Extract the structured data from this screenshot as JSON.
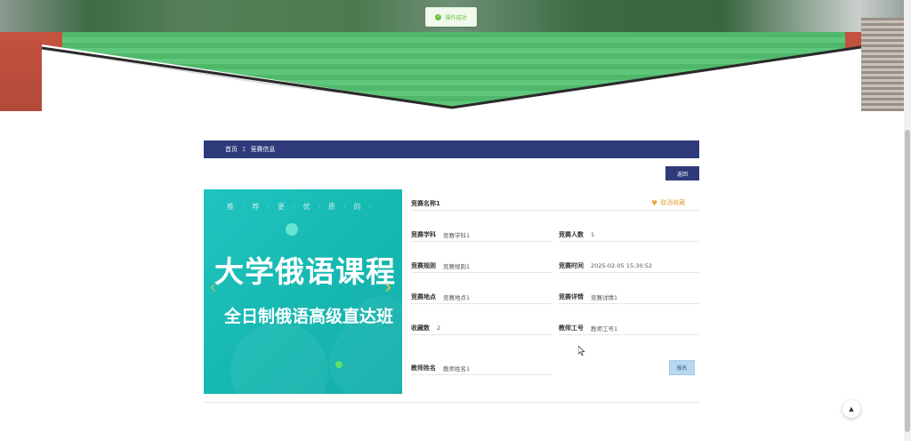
{
  "toast": {
    "text": "操作成功",
    "icon": "check-circle-icon",
    "color": "#67c23a"
  },
  "breadcrumb": {
    "home": "首页",
    "separator": "Ξ",
    "current": "竞赛信息"
  },
  "back_button": "返回",
  "carousel": {
    "top_text": "推·荐·更·优·质·的·",
    "title": "大学俄语课程",
    "subtitle": "全日制俄语高级直达班",
    "prev_icon": "chevron-left-icon",
    "next_icon": "chevron-right-icon"
  },
  "detail": {
    "title": "竞赛名称1",
    "favorite": {
      "label": "取消收藏",
      "icon": "heart-icon"
    },
    "fields": {
      "subject": {
        "label": "竞赛学科",
        "value": "竞赛学科1"
      },
      "count": {
        "label": "竞赛人数",
        "value": "1"
      },
      "rules": {
        "label": "竞赛规则",
        "value": "竞赛规则1"
      },
      "time": {
        "label": "竞赛时间",
        "value": "2025-02-05 15:30:52"
      },
      "location": {
        "label": "竞赛地点",
        "value": "竞赛地点1"
      },
      "details": {
        "label": "竞赛详情",
        "value": "竞赛详情1"
      },
      "favorites": {
        "label": "收藏数",
        "value": "2"
      },
      "teacher_id": {
        "label": "教师工号",
        "value": "教师工号1"
      },
      "teacher_name": {
        "label": "教师姓名",
        "value": "教师姓名1"
      }
    },
    "register_button": "报名"
  },
  "back_to_top": {
    "icon": "arrow-up-icon",
    "symbol": "▲"
  },
  "colors": {
    "primary": "#2e3a7a",
    "accent": "#e6a23c",
    "success": "#67c23a",
    "carousel_bg": "#1bbfb9"
  }
}
